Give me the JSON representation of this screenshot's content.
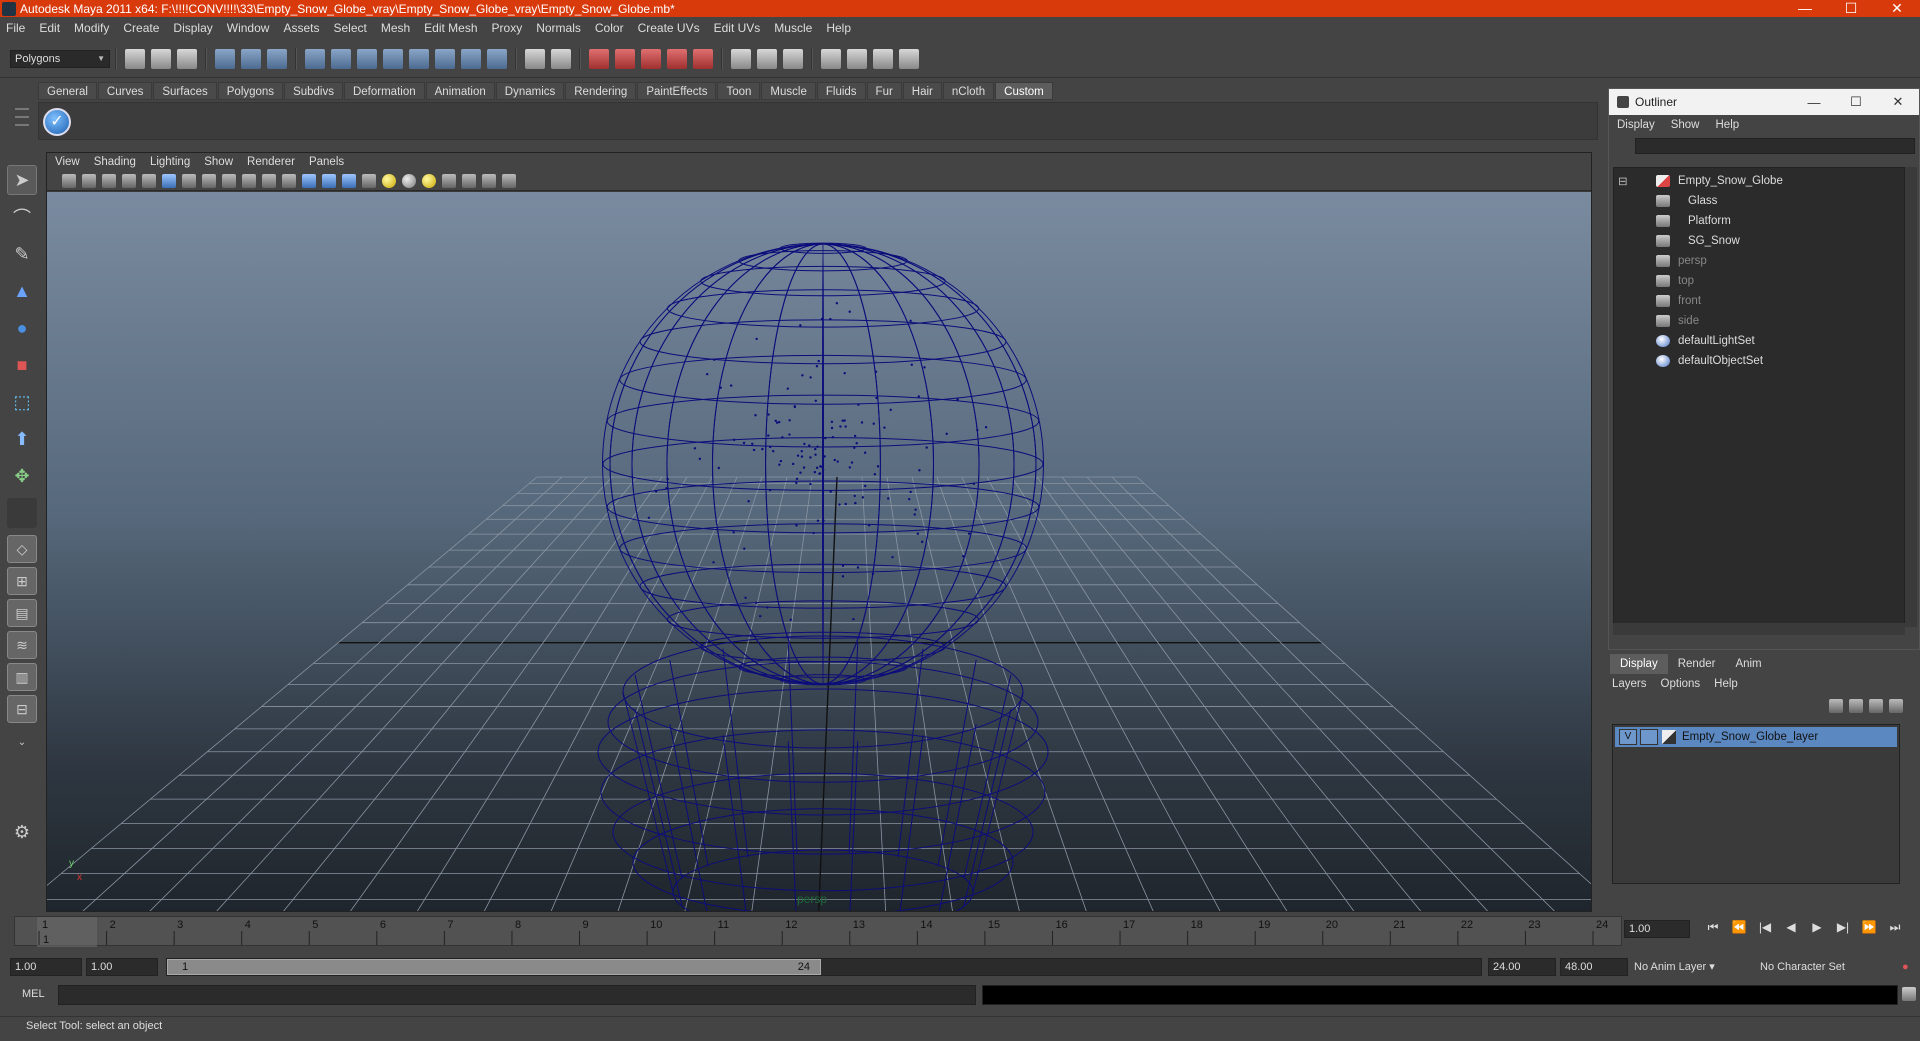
{
  "window": {
    "title": "Autodesk Maya 2011 x64: F:\\!!!!CONV!!!!\\33\\Empty_Snow_Globe_vray\\Empty_Snow_Globe_vray\\Empty_Snow_Globe.mb*",
    "minimize": "—",
    "maximize": "☐",
    "close": "✕"
  },
  "menubar": [
    "File",
    "Edit",
    "Modify",
    "Create",
    "Display",
    "Window",
    "Assets",
    "Select",
    "Mesh",
    "Edit Mesh",
    "Proxy",
    "Normals",
    "Color",
    "Create UVs",
    "Edit UVs",
    "Muscle",
    "Help"
  ],
  "statusline": {
    "mode": "Polygons"
  },
  "shelf": {
    "tabs": [
      "General",
      "Curves",
      "Surfaces",
      "Polygons",
      "Subdivs",
      "Deformation",
      "Animation",
      "Dynamics",
      "Rendering",
      "PaintEffects",
      "Toon",
      "Muscle",
      "Fluids",
      "Fur",
      "Hair",
      "nCloth",
      "Custom"
    ],
    "active_tab": "Custom"
  },
  "viewport": {
    "menus": [
      "View",
      "Shading",
      "Lighting",
      "Show",
      "Renderer",
      "Panels"
    ],
    "camera_label": "persp",
    "axis_x": "x",
    "axis_y": "y",
    "wire_color": "#0d0d7a"
  },
  "outliner": {
    "title": "Outliner",
    "menus": [
      "Display",
      "Show",
      "Help"
    ],
    "items": [
      {
        "label": "Empty_Snow_Globe",
        "kind": "transform",
        "dim": false
      },
      {
        "label": "Glass",
        "kind": "mesh",
        "dim": false
      },
      {
        "label": "Platform",
        "kind": "mesh",
        "dim": false
      },
      {
        "label": "SG_Snow",
        "kind": "mesh",
        "dim": false
      },
      {
        "label": "persp",
        "kind": "camera",
        "dim": true
      },
      {
        "label": "top",
        "kind": "camera",
        "dim": true
      },
      {
        "label": "front",
        "kind": "camera",
        "dim": true
      },
      {
        "label": "side",
        "kind": "camera",
        "dim": true
      },
      {
        "label": "defaultLightSet",
        "kind": "set",
        "dim": false
      },
      {
        "label": "defaultObjectSet",
        "kind": "set",
        "dim": false
      }
    ]
  },
  "layer_editor": {
    "tabs": [
      "Display",
      "Render",
      "Anim"
    ],
    "active_tab": "Display",
    "menus": [
      "Layers",
      "Options",
      "Help"
    ],
    "layers": [
      {
        "visible": "V",
        "name": "Empty_Snow_Globe_layer"
      }
    ]
  },
  "time_slider": {
    "ticks": [
      "1",
      "2",
      "3",
      "4",
      "5",
      "6",
      "7",
      "8",
      "9",
      "10",
      "11",
      "12",
      "13",
      "14",
      "15",
      "16",
      "17",
      "18",
      "19",
      "20",
      "21",
      "22",
      "23",
      "24"
    ],
    "current_frame": "1.00",
    "current_marker": "1"
  },
  "playback": [
    "⏮",
    "⏪",
    "|◀",
    "◀",
    "▶",
    "▶|",
    "⏩",
    "⏭"
  ],
  "range_slider": {
    "start": "1.00",
    "anim_start": "1.00",
    "range_start": "1",
    "range_end": "24",
    "anim_end": "24.00",
    "end": "48.00",
    "anim_layer": "No Anim Layer",
    "character_set": "No Character Set"
  },
  "command_line": {
    "label": "MEL"
  },
  "help_line": {
    "text": "Select Tool: select an object"
  }
}
